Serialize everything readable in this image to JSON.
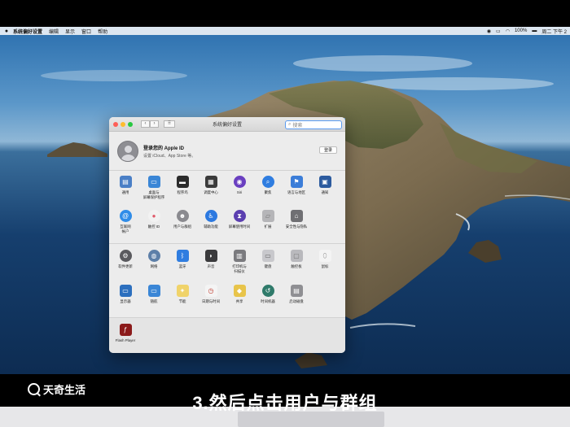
{
  "menubar": {
    "apple_icon": "apple-icon",
    "app_name": "系统偏好设置",
    "menus": [
      "编辑",
      "显示",
      "窗口",
      "帮助"
    ],
    "battery": "100%",
    "clock": "周二 下午 2"
  },
  "window": {
    "title": "系统偏好设置",
    "search_placeholder": "搜索",
    "back_label": "‹",
    "forward_label": "›",
    "grid_label": "⠿"
  },
  "account": {
    "title": "登录您的 Apple ID",
    "subtitle": "设置 iCloud、App Store 等。",
    "login_button": "登录"
  },
  "panes": {
    "row1": [
      {
        "label": "通用",
        "icon": "general-icon",
        "color": "#4a7fc6"
      },
      {
        "label": "桌面与\n屏幕保护程序",
        "icon": "desktop-icon",
        "color": "#3a86d6"
      },
      {
        "label": "程序坞",
        "icon": "dock-icon",
        "color": "#2b2b2b"
      },
      {
        "label": "调度中心",
        "icon": "mission-control-icon",
        "color": "#3b3b3b"
      },
      {
        "label": "Siri",
        "icon": "siri-icon",
        "color": "#6a3fc0"
      },
      {
        "label": "聚焦",
        "icon": "spotlight-icon",
        "color": "#2f7de0"
      },
      {
        "label": "语言与地区",
        "icon": "language-icon",
        "color": "#3b7dd8"
      },
      {
        "label": "通知",
        "icon": "notifications-icon",
        "color": "#2c5b9e"
      }
    ],
    "row2": [
      {
        "label": "互联网\n帐户",
        "icon": "internet-accounts-icon",
        "color": "#2f8ce8"
      },
      {
        "label": "触控 ID",
        "icon": "touch-id-icon",
        "color": "#f2f2f2"
      },
      {
        "label": "用户与群组",
        "icon": "users-groups-icon",
        "color": "#8a8a8f"
      },
      {
        "label": "辅助功能",
        "icon": "accessibility-icon",
        "color": "#2c79e0"
      },
      {
        "label": "屏幕使用时间",
        "icon": "screen-time-icon",
        "color": "#5b3fb0"
      },
      {
        "label": "扩展",
        "icon": "extensions-icon",
        "color": "#b5b5b8"
      },
      {
        "label": "安全性与隐私",
        "icon": "security-icon",
        "color": "#6f6f73"
      }
    ],
    "row3": [
      {
        "label": "软件更新",
        "icon": "software-update-icon",
        "color": "#5a5a5e"
      },
      {
        "label": "网络",
        "icon": "network-icon",
        "color": "#5d7fa8"
      },
      {
        "label": "蓝牙",
        "icon": "bluetooth-icon",
        "color": "#2f7de0"
      },
      {
        "label": "声音",
        "icon": "sound-icon",
        "color": "#3a3a3c"
      },
      {
        "label": "打印机与\n扫描仪",
        "icon": "printers-icon",
        "color": "#7a7a7e"
      },
      {
        "label": "键盘",
        "icon": "keyboard-icon",
        "color": "#c8c8cc"
      },
      {
        "label": "触控板",
        "icon": "trackpad-icon",
        "color": "#b9b9bd"
      },
      {
        "label": "鼠标",
        "icon": "mouse-icon",
        "color": "#f4f4f4"
      }
    ],
    "row4": [
      {
        "label": "显示器",
        "icon": "displays-icon",
        "color": "#2c6fbe"
      },
      {
        "label": "随航",
        "icon": "sidecar-icon",
        "color": "#3a86d6"
      },
      {
        "label": "节能",
        "icon": "energy-saver-icon",
        "color": "#f0d36a"
      },
      {
        "label": "日期与时间",
        "icon": "date-time-icon",
        "color": "#f4f4f4"
      },
      {
        "label": "共享",
        "icon": "sharing-icon",
        "color": "#e8c44a"
      },
      {
        "label": "时间机器",
        "icon": "time-machine-icon",
        "color": "#2f7a6a"
      },
      {
        "label": "启动磁盘",
        "icon": "startup-disk-icon",
        "color": "#8f8f93"
      }
    ],
    "row5": [
      {
        "label": "Flash Player",
        "icon": "flash-player-icon",
        "color": "#8b1a1a"
      }
    ]
  },
  "caption": {
    "watermark": "天奇生活",
    "text": "3.然后点击用户与群组"
  }
}
